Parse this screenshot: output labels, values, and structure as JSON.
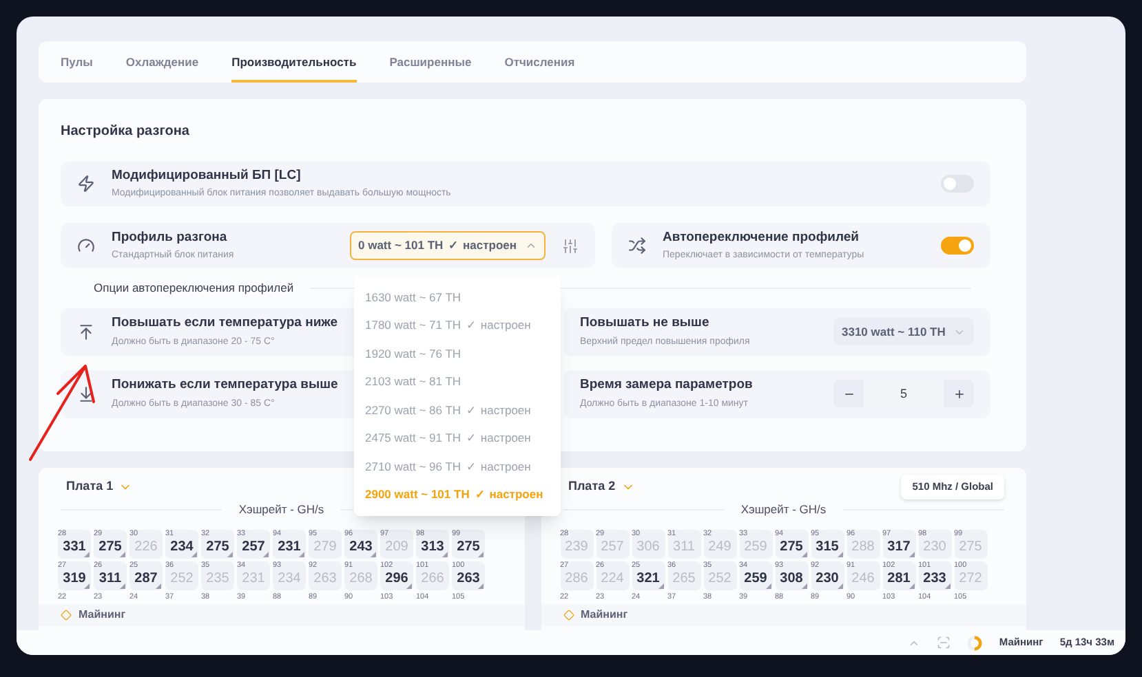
{
  "tabs": [
    {
      "label": "Пулы",
      "selected": false
    },
    {
      "label": "Охлаждение",
      "selected": false
    },
    {
      "label": "Производительность",
      "selected": true
    },
    {
      "label": "Расширенные",
      "selected": false
    },
    {
      "label": "Отчисления",
      "selected": false
    }
  ],
  "section_title": "Настройка разгона",
  "modified_psu": {
    "title": "Модифицированный БП [LC]",
    "subtitle": "Модифицированный блок питания позволяет выдавать большую мощность",
    "on": false
  },
  "profile": {
    "title": "Профиль разгона",
    "subtitle": "Стандартный блок питания",
    "value": "0 watt ~ 101 TH",
    "status": "✓ настроен",
    "expanded": true
  },
  "auto_switch": {
    "title": "Автопереключение профилей",
    "subtitle": "Переключает в зависимости от температуры",
    "on": true
  },
  "options_heading": "Опции автопереключения профилей",
  "raise_below": {
    "title": "Повышать если температура ниже",
    "subtitle": "Должно быть в диапазоне 20 - 75 C°"
  },
  "raise_max": {
    "title": "Повышать не выше",
    "subtitle": "Верхний предел повышения профиля",
    "value": "3310 watt ~ 110 TH"
  },
  "lower_above": {
    "title": "Понижать если температура выше",
    "subtitle": "Должно быть в диапазоне 30 - 85 C°"
  },
  "measure_time": {
    "title": "Время замера параметров",
    "subtitle": "Должно быть в диапазоне 1-10 минут",
    "value": "5"
  },
  "profile_options": [
    {
      "label": "1630 watt ~ 67 TH",
      "selected": false
    },
    {
      "label": "1780 watt ~ 71 TH",
      "status": "✓ настроен",
      "selected": false
    },
    {
      "label": "1920 watt ~ 76 TH",
      "selected": false
    },
    {
      "label": "2103 watt ~ 81 TH",
      "selected": false
    },
    {
      "label": "2270 watt ~ 86 TH",
      "status": "✓ настроен",
      "selected": false
    },
    {
      "label": "2475 watt ~ 91 TH",
      "status": "✓ настроен",
      "selected": false
    },
    {
      "label": "2710 watt ~ 96 TH",
      "status": "✓ настроен",
      "selected": false
    },
    {
      "label": "2900 watt ~ 101 TH",
      "status": "✓ настроен",
      "selected": true
    }
  ],
  "boards": [
    {
      "title": "Плата 1",
      "chart_title": "Хэшрейт - GH/s",
      "footer": "Майнинг",
      "rows": [
        [
          {
            "label": "28",
            "value": "331",
            "active": true
          },
          {
            "label": "29",
            "value": "275",
            "active": true
          },
          {
            "label": "30",
            "value": "226",
            "active": false
          },
          {
            "label": "31",
            "value": "234",
            "active": true
          },
          {
            "label": "32",
            "value": "275",
            "active": true
          },
          {
            "label": "33",
            "value": "257",
            "active": true
          },
          {
            "label": "94",
            "value": "231",
            "active": true
          },
          {
            "label": "95",
            "value": "279",
            "active": false
          },
          {
            "label": "96",
            "value": "243",
            "active": true
          },
          {
            "label": "97",
            "value": "209",
            "active": false
          },
          {
            "label": "98",
            "value": "313",
            "active": true
          },
          {
            "label": "99",
            "value": "275",
            "active": true
          }
        ],
        [
          {
            "label": "27",
            "value": "319",
            "active": true
          },
          {
            "label": "26",
            "value": "311",
            "active": true
          },
          {
            "label": "25",
            "value": "287",
            "active": true
          },
          {
            "label": "36",
            "value": "252",
            "active": false
          },
          {
            "label": "35",
            "value": "235",
            "active": false
          },
          {
            "label": "34",
            "value": "231",
            "active": false
          },
          {
            "label": "93",
            "value": "234",
            "active": false
          },
          {
            "label": "92",
            "value": "263",
            "active": false
          },
          {
            "label": "91",
            "value": "268",
            "active": false
          },
          {
            "label": "102",
            "value": "296",
            "active": true
          },
          {
            "label": "101",
            "value": "266",
            "active": false
          },
          {
            "label": "100",
            "value": "263",
            "active": true
          }
        ],
        [
          {
            "label": "22"
          },
          {
            "label": "23"
          },
          {
            "label": "24"
          },
          {
            "label": "37"
          },
          {
            "label": "38"
          },
          {
            "label": "39"
          },
          {
            "label": "88"
          },
          {
            "label": "89"
          },
          {
            "label": "90"
          },
          {
            "label": "103"
          },
          {
            "label": "104"
          },
          {
            "label": "105"
          }
        ]
      ]
    },
    {
      "title": "Плата 2",
      "badge": "510 Mhz / Global",
      "chart_title": "Хэшрейт - GH/s",
      "footer": "Майнинг",
      "rows": [
        [
          {
            "label": "28",
            "value": "239",
            "active": false
          },
          {
            "label": "29",
            "value": "257",
            "active": false
          },
          {
            "label": "30",
            "value": "306",
            "active": false
          },
          {
            "label": "31",
            "value": "311",
            "active": false
          },
          {
            "label": "32",
            "value": "249",
            "active": false
          },
          {
            "label": "33",
            "value": "259",
            "active": false
          },
          {
            "label": "94",
            "value": "275",
            "active": true
          },
          {
            "label": "95",
            "value": "315",
            "active": true
          },
          {
            "label": "96",
            "value": "288",
            "active": false
          },
          {
            "label": "97",
            "value": "317",
            "active": true
          },
          {
            "label": "98",
            "value": "230",
            "active": false
          },
          {
            "label": "99",
            "value": "275",
            "active": false
          }
        ],
        [
          {
            "label": "27",
            "value": "286",
            "active": false
          },
          {
            "label": "26",
            "value": "224",
            "active": false
          },
          {
            "label": "25",
            "value": "321",
            "active": true
          },
          {
            "label": "36",
            "value": "265",
            "active": false
          },
          {
            "label": "35",
            "value": "252",
            "active": false
          },
          {
            "label": "34",
            "value": "259",
            "active": true
          },
          {
            "label": "93",
            "value": "308",
            "active": true
          },
          {
            "label": "92",
            "value": "230",
            "active": true
          },
          {
            "label": "91",
            "value": "246",
            "active": false
          },
          {
            "label": "102",
            "value": "281",
            "active": true
          },
          {
            "label": "101",
            "value": "233",
            "active": true
          },
          {
            "label": "100",
            "value": "272",
            "active": false
          }
        ],
        [
          {
            "label": "22"
          },
          {
            "label": "23"
          },
          {
            "label": "24"
          },
          {
            "label": "37"
          },
          {
            "label": "38"
          },
          {
            "label": "39"
          },
          {
            "label": "88"
          },
          {
            "label": "89"
          },
          {
            "label": "90"
          },
          {
            "label": "103"
          },
          {
            "label": "104"
          },
          {
            "label": "105"
          }
        ]
      ]
    }
  ],
  "status_bar": {
    "state": "Майнинг",
    "uptime": "5д 13ч 33м"
  }
}
